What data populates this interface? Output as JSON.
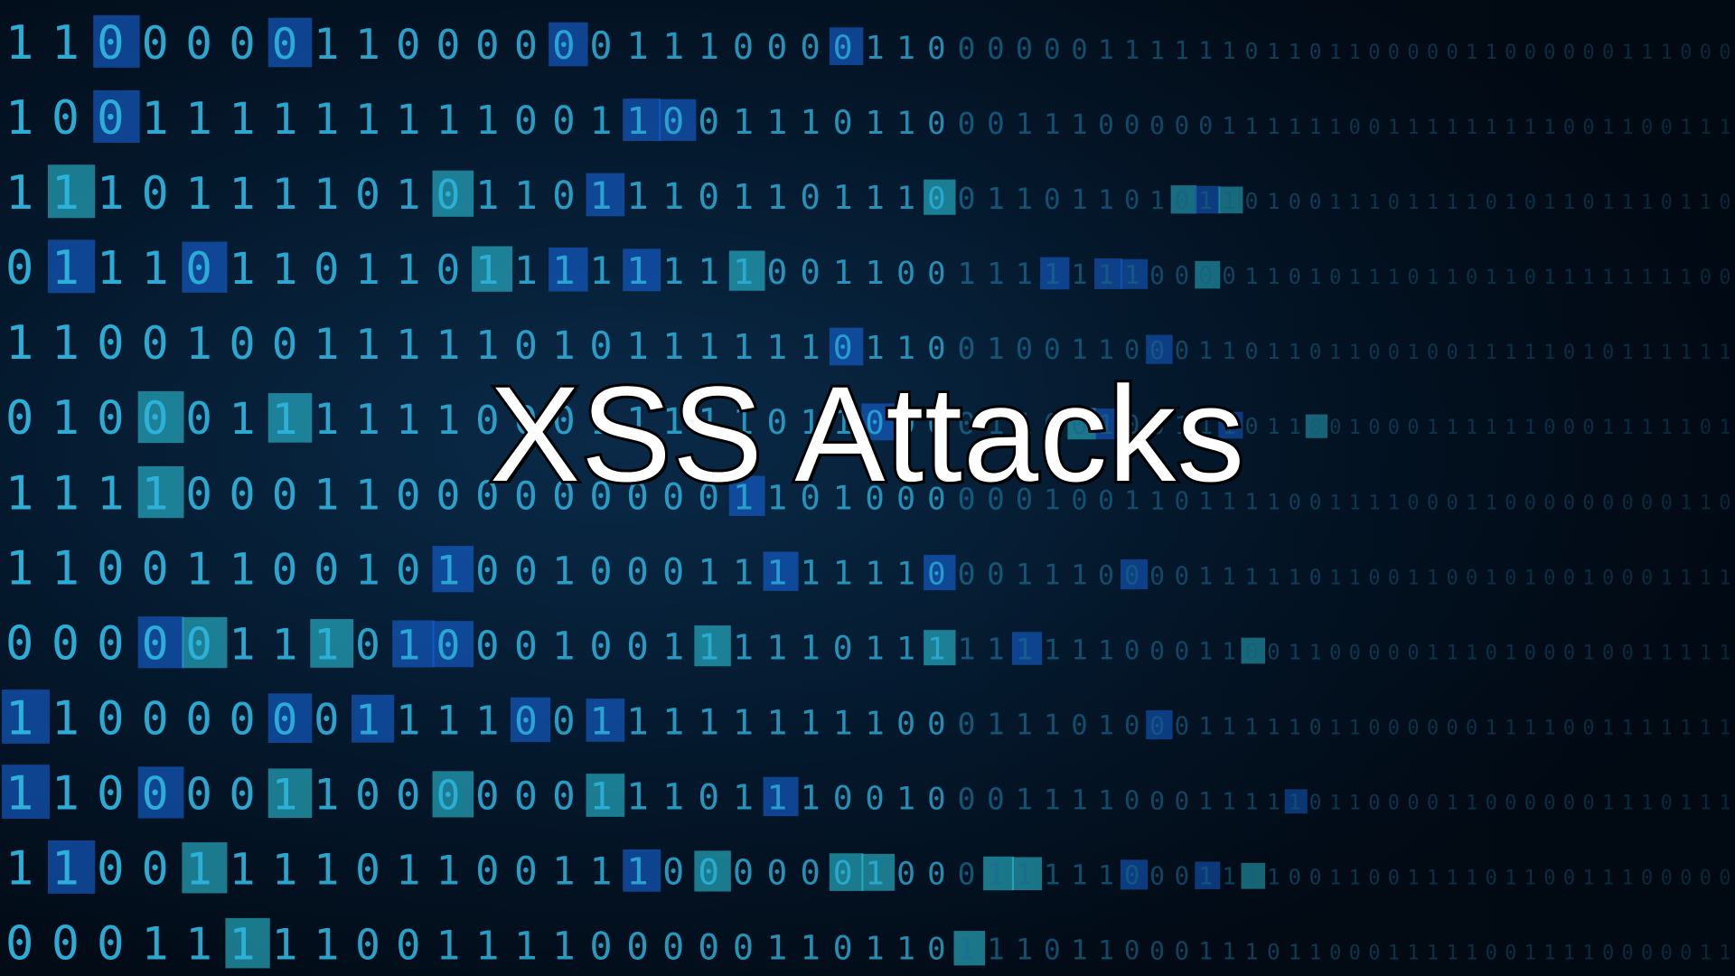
{
  "title": "XSS Attacks",
  "background": {
    "description_icon": "binary-code-matrix",
    "colors": {
      "base": "#02101e",
      "digit": "#2fb6e0",
      "digit_dim": "#1a6f94",
      "highlight_cell": "#1664d8",
      "highlight_cell_bright": "#2fd2e8"
    },
    "rows": [
      "1100000110000001110000110000001111110110",
      "1001111111110011001110110001110000011111",
      "1110111101011011101101110011011010110100",
      "0111011011011111111001100111111100001101",
      "1100100111110101111110110010011000110110",
      "0100011111100011111011000011001001110110",
      "1111000110000000001101000000100110111100",
      "1100110010100100011111110001110000111110",
      "0000011101000100111110111111111000110011",
      "1100000011110011111111100011101000111110",
      "1100001100000011101110010001111000111110",
      "1100111101100111000000100011111000111100",
      "0001111100111100000110110111011000111011"
    ]
  }
}
